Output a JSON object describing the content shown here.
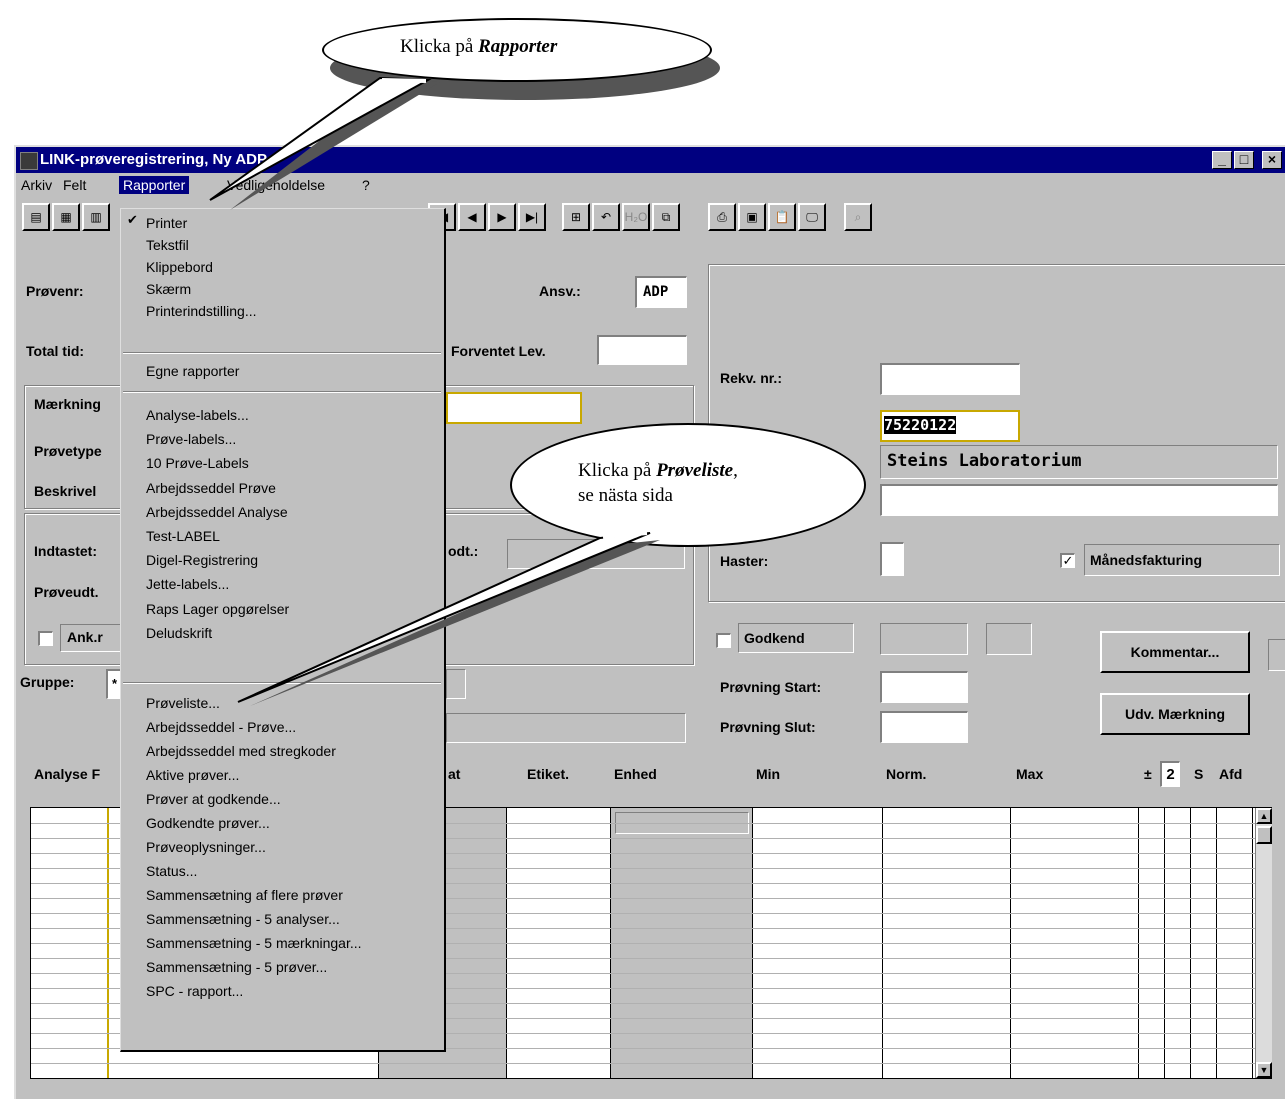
{
  "callout_top": {
    "prefix": "Klicka på ",
    "emph": "Rapporter"
  },
  "callout_mid": {
    "prefix": "Klicka på ",
    "emph": "Prøveliste",
    "suffix": ",",
    "line2": "se nästa sida"
  },
  "window": {
    "title": "LINK-prøveregistrering, Ny ADP"
  },
  "menubar": [
    "Arkiv",
    "Felt",
    "Rapporter",
    "Vedligeholdelse",
    "?"
  ],
  "dropdown": {
    "checked_mark": "✔",
    "group1": [
      "Printer",
      "Tekstfil",
      "Klippebord",
      "Skærm",
      "Printerindstilling..."
    ],
    "group2": [
      "Egne rapporter"
    ],
    "group3": [
      "Analyse-labels...",
      "Prøve-labels...",
      "10 Prøve-Labels",
      "Arbejdsseddel Prøve",
      "Arbejdsseddel Analyse",
      "Test-LABEL",
      "Digel-Registrering",
      "Jette-labels...",
      "Raps Lager opgørelser",
      "Deludskrift"
    ],
    "group4": [
      "Prøveliste...",
      "Arbejdsseddel - Prøve...",
      "Arbejdsseddel med stregkoder",
      "Aktive prøver...",
      "Prøver at godkende...",
      "Godkendte prøver...",
      "Prøveoplysninger...",
      "Status...",
      "Sammensætning af flere prøver",
      "Sammensætning - 5 analyser...",
      "Sammensætning - 5 mærkningar...",
      "Sammensætning - 5 prøver...",
      "SPC - rapport..."
    ]
  },
  "form": {
    "provenr_label": "Prøvenr:",
    "ansv_label": "Ansv.:",
    "ansv_value": "ADP",
    "total_tid_label": "Total tid:",
    "forventet_label": "Forventet Lev.",
    "maerkning_label": "Mærkning",
    "provetype_label": "Prøvetype",
    "beskrivelse_label": "Beskrivel",
    "indtastet_label": "Indtastet:",
    "modt_label": "odt.:",
    "proveudt_label": "Prøveudt.",
    "ankr_label": "Ank.r",
    "gruppe_label": "Gruppe:",
    "gruppe_value": "*",
    "rekv_label": "Rekv. nr.:",
    "number_value": "75220122",
    "lab_value": "Steins Laboratorium",
    "haster_label": "Haster:",
    "manedsfakturing_label": "Månedsfakturing",
    "godkend_label": "Godkend",
    "kommentar_button": "Kommentar...",
    "udv_button": "Udv. Mærkning",
    "provning_start_label": "Prøvning Start:",
    "provning_slut_label": "Prøvning Slut:"
  },
  "grid": {
    "headers": {
      "analyse": "Analyse F",
      "at": "at",
      "etiket": "Etiket.",
      "enhed": "Enhed",
      "min": "Min",
      "norm": "Norm.",
      "max": "Max",
      "pm": "±",
      "spin": "2",
      "s": "S",
      "afd": "Afd"
    }
  }
}
